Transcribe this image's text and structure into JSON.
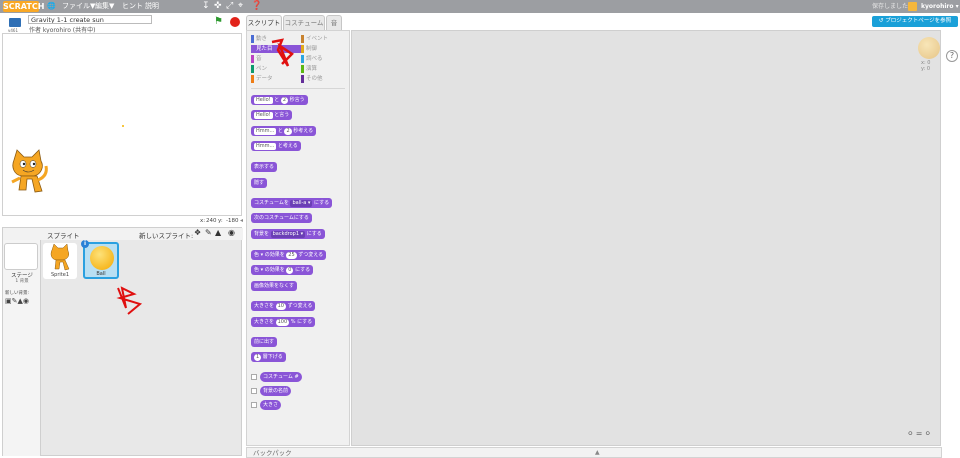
{
  "menubar": {
    "logo": "SCRATCH",
    "globe_label": "",
    "file": "ファイル▼",
    "edit": "編集▼",
    "tips": "ヒント",
    "about": "説明",
    "status": "保存しました",
    "username": "kyorohiro ▾"
  },
  "stage": {
    "version": "v461",
    "project_title": "Gravity 1-1 create sun",
    "author": "作者 kyorohiro (共有中)",
    "coords_x_label": "x:",
    "coords_x": "240",
    "coords_y_label": "y:",
    "coords_y": "-180"
  },
  "sprites": {
    "header": "スプライト",
    "new_sprite_label": "新しいスプライト:",
    "stage_label": "ステージ",
    "stage_backdrops": "1 背景",
    "new_backdrop_label": "新しい背景:",
    "items": [
      {
        "name": "Sprite1"
      },
      {
        "name": "Ball"
      }
    ]
  },
  "tabs": [
    "スクリプト",
    "コスチューム",
    "音"
  ],
  "project_page_button": "プロジェクトページを参照",
  "categories": [
    {
      "label": "動き",
      "color": "#4a6cd4"
    },
    {
      "label": "見た目",
      "color": "#8a55d7"
    },
    {
      "label": "音",
      "color": "#bb42c3"
    },
    {
      "label": "ペン",
      "color": "#0e9a6c"
    },
    {
      "label": "データ",
      "color": "#ee7d16"
    },
    {
      "label": "イベント",
      "color": "#c88330"
    },
    {
      "label": "制御",
      "color": "#e1a91a"
    },
    {
      "label": "調べる",
      "color": "#2ca5e2"
    },
    {
      "label": "演算",
      "color": "#5cb712"
    },
    {
      "label": "その他",
      "color": "#632d99"
    }
  ],
  "blocks": {
    "say_for": {
      "slot": "Hello!",
      "mid": "と",
      "num": "2",
      "end": "秒言う"
    },
    "say": {
      "slot": "Hello!",
      "end": "と言う"
    },
    "think_for": {
      "slot": "Hmm...",
      "mid": "と",
      "num": "2",
      "end": "秒考える"
    },
    "think": {
      "slot": "Hmm...",
      "end": "と考える"
    },
    "show": "表示する",
    "hide": "隠す",
    "switch_costume": {
      "pre": "コスチュームを",
      "slot": "ball-a ▾",
      "end": "にする"
    },
    "next_costume": "次のコスチュームにする",
    "switch_backdrop": {
      "pre": "背景を",
      "slot": "backdrop1 ▾",
      "end": "にする"
    },
    "change_effect": {
      "pre": "色 ▾ の効果を",
      "num": "25",
      "end": "ずつ変える"
    },
    "set_effect": {
      "pre": "色 ▾ の効果を",
      "num": "0",
      "end": "にする"
    },
    "clear_effects": "画像効果をなくす",
    "change_size": {
      "pre": "大きさを",
      "num": "10",
      "end": "ずつ変える"
    },
    "set_size": {
      "pre": "大きさを",
      "num": "100",
      "end": "% にする"
    },
    "go_front": "前に出す",
    "go_back": {
      "num": "1",
      "end": "層下げる"
    },
    "rep_costume": "コスチューム #",
    "rep_backdrop": "背景の名前",
    "rep_size": "大きさ"
  },
  "sprite_info": {
    "x": "x: 0",
    "y": "y: 0"
  },
  "backpack": "バックパック"
}
